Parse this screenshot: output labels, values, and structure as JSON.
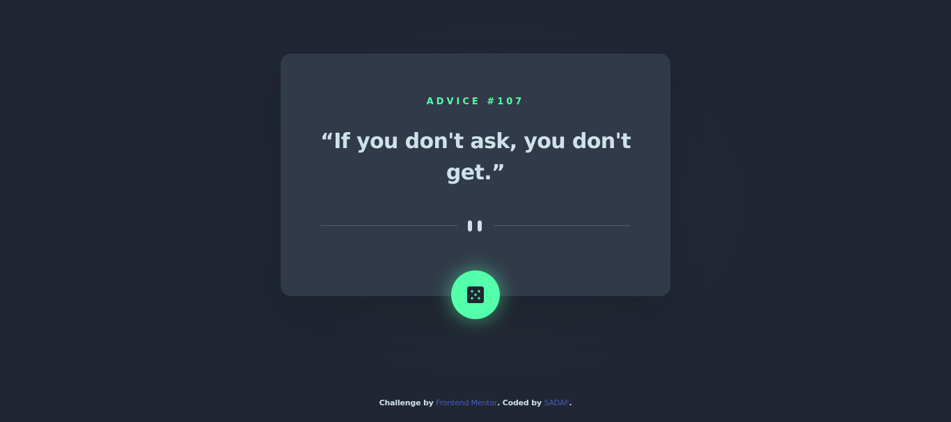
{
  "advice": {
    "label_prefix": "ADVICE #",
    "number": "107",
    "text": "“If you don't ask, you don't get.”"
  },
  "icons": {
    "divider": "pause-icon",
    "generate": "dice-icon"
  },
  "footer": {
    "prefix": "Challenge by ",
    "link1": "Frontend Mentor",
    "middle": ". Coded by ",
    "link2": "SADAF",
    "suffix": "."
  },
  "colors": {
    "background": "#202632",
    "card": "#313a48",
    "accent": "#53ffaa",
    "text": "#cee3e9",
    "link": "#4a5cc2"
  }
}
